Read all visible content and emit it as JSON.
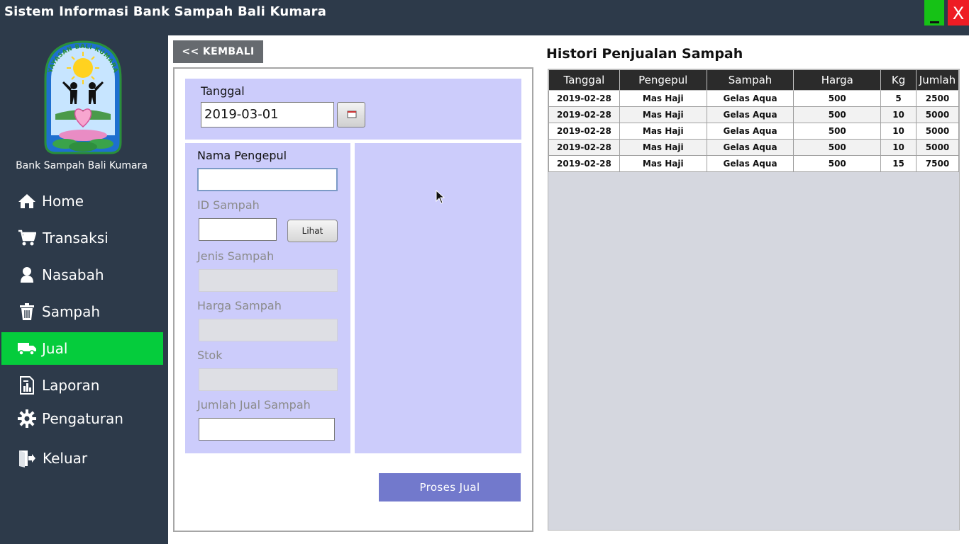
{
  "window": {
    "title": "Sistem Informasi Bank Sampah Bali Kumara",
    "minimize_label": "_",
    "close_label": "X"
  },
  "sidebar": {
    "logo_text": "YAYASAN BALI KUMARA",
    "brand_name": "Bank Sampah Bali Kumara",
    "items": [
      {
        "label": "Home",
        "icon": "home-icon",
        "active": false
      },
      {
        "label": "Transaksi",
        "icon": "cart-icon",
        "active": false
      },
      {
        "label": "Nasabah",
        "icon": "user-icon",
        "active": false
      },
      {
        "label": "Sampah",
        "icon": "trash-icon",
        "active": false
      },
      {
        "label": "Jual",
        "icon": "truck-icon",
        "active": true
      },
      {
        "label": "Laporan",
        "icon": "report-icon",
        "active": false
      },
      {
        "label": "Pengaturan",
        "icon": "gear-icon",
        "active": false
      },
      {
        "label": "Keluar",
        "icon": "exit-icon",
        "active": false
      }
    ]
  },
  "form": {
    "back_label": "<< KEMBALI",
    "tanggal_label": "Tanggal",
    "tanggal_value": "2019-03-01",
    "nama_pengepul_label": "Nama Pengepul",
    "nama_pengepul_value": "",
    "id_sampah_label": "ID Sampah",
    "id_sampah_value": "",
    "lihat_label": "Lihat",
    "jenis_sampah_label": "Jenis Sampah",
    "harga_sampah_label": "Harga Sampah",
    "stok_label": "Stok",
    "jumlah_jual_label": "Jumlah Jual Sampah",
    "jumlah_jual_value": "",
    "proses_label": "Proses Jual"
  },
  "history": {
    "title": "Histori Penjualan Sampah",
    "columns": [
      "Tanggal",
      "Pengepul",
      "Sampah",
      "Harga",
      "Kg",
      "Jumlah"
    ],
    "rows": [
      [
        "2019-02-28",
        "Mas Haji",
        "Gelas Aqua",
        "500",
        "5",
        "2500"
      ],
      [
        "2019-02-28",
        "Mas Haji",
        "Gelas Aqua",
        "500",
        "10",
        "5000"
      ],
      [
        "2019-02-28",
        "Mas Haji",
        "Gelas Aqua",
        "500",
        "10",
        "5000"
      ],
      [
        "2019-02-28",
        "Mas Haji",
        "Gelas Aqua",
        "500",
        "10",
        "5000"
      ],
      [
        "2019-02-28",
        "Mas Haji",
        "Gelas Aqua",
        "500",
        "15",
        "7500"
      ]
    ]
  },
  "colors": {
    "sidebar_bg": "#2d3a4a",
    "active_nav": "#05cc3c",
    "form_panel": "#ccccfb",
    "proses_button": "#7279cc",
    "table_header": "#2b2b2b"
  }
}
